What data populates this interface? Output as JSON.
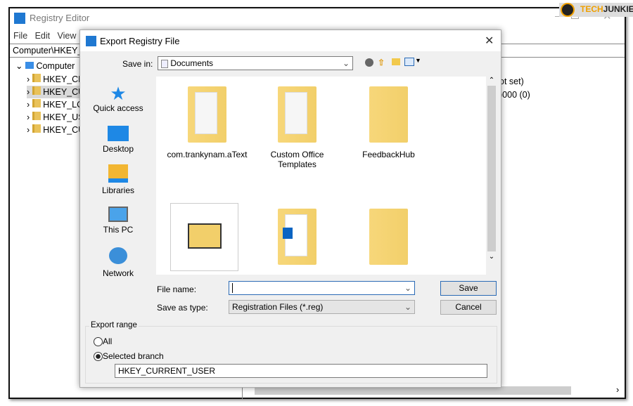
{
  "registry": {
    "title": "Registry Editor",
    "menu": [
      "File",
      "Edit",
      "View"
    ],
    "address": "Computer\\HKEY_C",
    "tree_root": "Computer",
    "tree_items": [
      "HKEY_CL",
      "HKEY_CU",
      "HKEY_LC",
      "HKEY_US",
      "HKEY_CU"
    ],
    "values": [
      "ot set)",
      ")000 (0)"
    ]
  },
  "watermark": {
    "text_a": "TECH",
    "text_b": "JUNKIE"
  },
  "dialog": {
    "title": "Export Registry File",
    "save_in_label": "Save in:",
    "save_in_value": "Documents",
    "places": [
      "Quick access",
      "Desktop",
      "Libraries",
      "This PC",
      "Network"
    ],
    "files": [
      "com.trankynam.aText",
      "Custom Office Templates",
      "FeedbackHub",
      "",
      "",
      ""
    ],
    "file_name_label": "File name:",
    "file_name_value": "",
    "save_as_type_label": "Save as type:",
    "save_as_type_value": "Registration Files (*.reg)",
    "save": "Save",
    "cancel": "Cancel",
    "export_range": "Export range",
    "opt_all": "All",
    "opt_branch": "Selected branch",
    "branch_value": "HKEY_CURRENT_USER",
    "selected_option": "Selected branch"
  }
}
